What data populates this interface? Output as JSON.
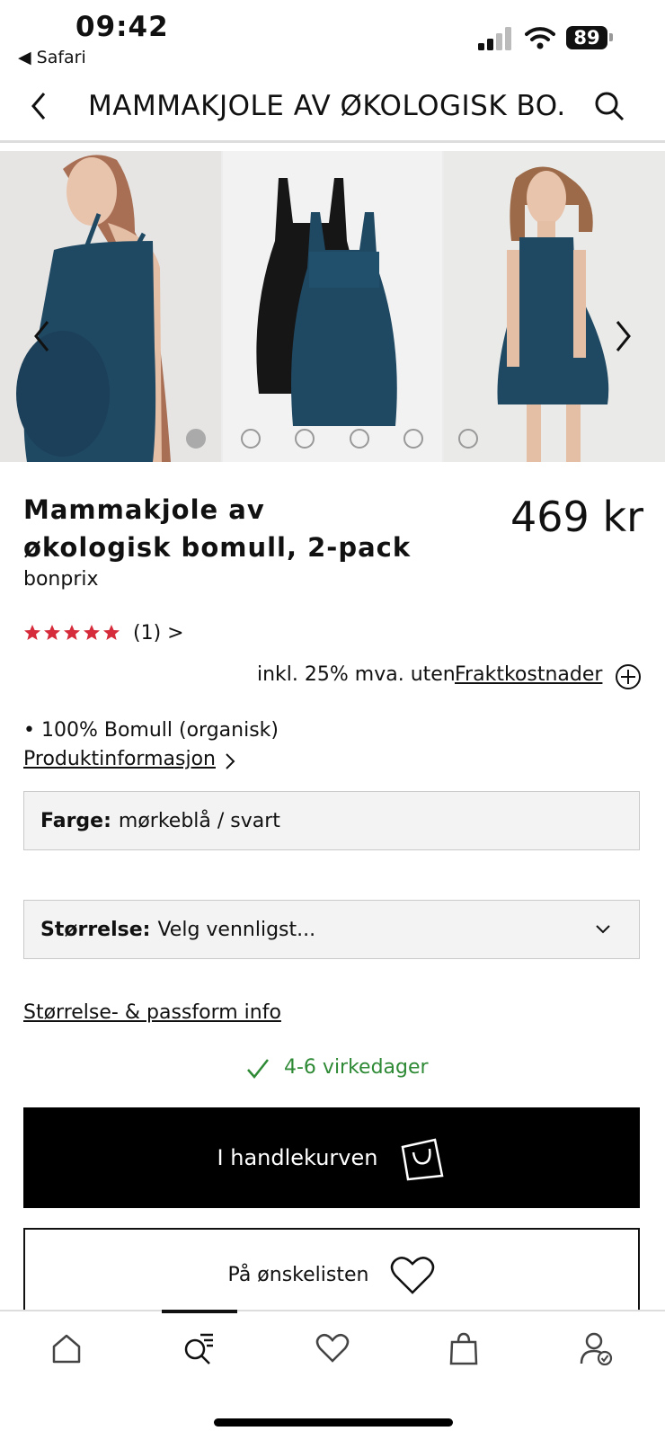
{
  "status_bar": {
    "time": "09:42",
    "back_app": "◀ Safari",
    "battery": "89"
  },
  "nav": {
    "title": "MAMMAKJOLE AV ØKOLOGISK BO...",
    "back_icon": "chevron-left-icon",
    "search_icon": "search-icon"
  },
  "gallery": {
    "image_count": 6,
    "active_index": 0
  },
  "product": {
    "title": "Mammakjole av økologisk bomull, 2-pack",
    "price": "469 kr",
    "brand": "bonprix",
    "rating": 5,
    "reviews": "(1) >",
    "vat_text": "inkl. 25% mva. uten",
    "shipping_link": "Fraktkostnader",
    "material": "• 100% Bomull (organisk)",
    "info_link": "Produktinformasjon"
  },
  "color_select": {
    "label": "Farge:",
    "value": "mørkeblå / svart"
  },
  "size_select": {
    "label": "Størrelse:",
    "value": "Velg vennligst..."
  },
  "size_info_link": "Størrelse- & passform info",
  "delivery": "4-6 virkedager",
  "buttons": {
    "cart": "I handlekurven",
    "wishlist": "På ønskelisten"
  },
  "colors": {
    "star": "#d62b3a",
    "delivery": "#2f8a36",
    "dress": "#1f4863"
  },
  "tabbar": {
    "items": [
      "home-icon",
      "search-list-icon",
      "heart-icon",
      "bag-icon",
      "account-icon"
    ],
    "active": 1
  }
}
